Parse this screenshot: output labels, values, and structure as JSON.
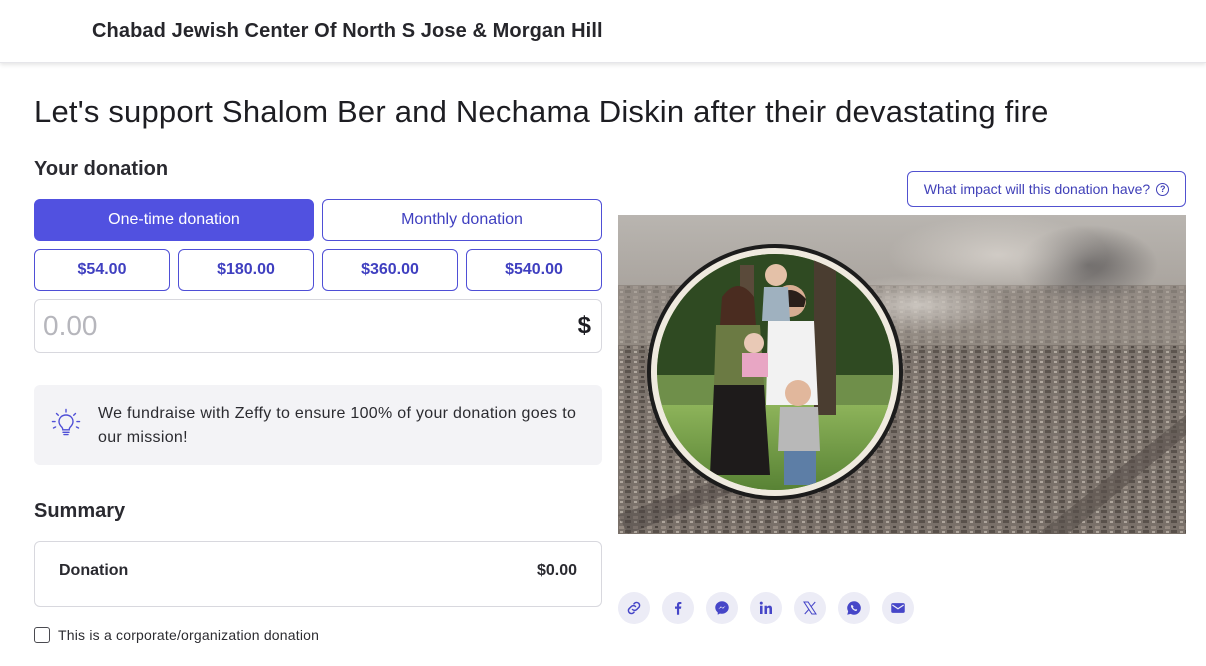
{
  "header": {
    "org_name": "Chabad Jewish Center Of North S Jose & Morgan Hill"
  },
  "page": {
    "title": "Let's support Shalom Ber and Nechama Diskin after their devastating fire"
  },
  "donation": {
    "heading": "Your donation",
    "frequency": {
      "one_time": "One-time donation",
      "monthly": "Monthly donation",
      "selected": "one_time"
    },
    "amounts": [
      "$54.00",
      "$180.00",
      "$360.00",
      "$540.00"
    ],
    "amount_field": {
      "value": "",
      "placeholder": "0.00",
      "currency_symbol": "$"
    }
  },
  "info": {
    "text": "We fundraise with Zeffy to ensure 100% of your donation goes to our mission!",
    "icon": "lightbulb-icon"
  },
  "summary": {
    "heading": "Summary",
    "label": "Donation",
    "value": "$0.00"
  },
  "corporate": {
    "label": "This is a corporate/organization donation",
    "checked": false
  },
  "impact": {
    "label": "What impact will this donation have?",
    "icon": "help-circle-icon"
  },
  "share": {
    "icons": [
      "link-icon",
      "facebook-icon",
      "messenger-icon",
      "linkedin-icon",
      "x-icon",
      "whatsapp-icon",
      "email-icon"
    ]
  },
  "colors": {
    "accent": "#5151e0",
    "accent_text": "#3f3fc0",
    "info_bg": "#f3f3f6",
    "share_bg": "#ececf6"
  }
}
